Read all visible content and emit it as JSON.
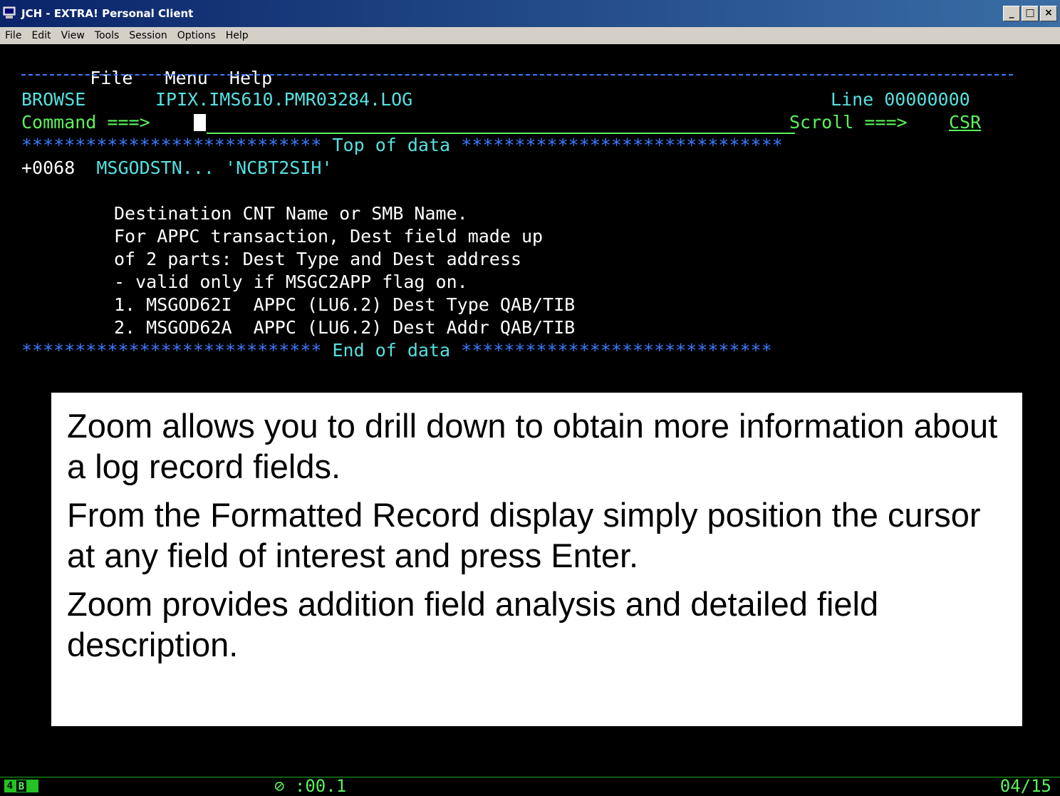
{
  "window": {
    "title": "JCH - EXTRA! Personal Client",
    "buttons": [
      "_",
      "□",
      "×"
    ]
  },
  "menubar": [
    "File",
    "Edit",
    "View",
    "Tools",
    "Session",
    "Options",
    "Help"
  ],
  "terminal": {
    "menu": {
      "file": "File",
      "menu": "Menu",
      "help": "Help"
    },
    "mode": "BROWSE",
    "dataset": "IPIX.IMS610.PMR03284.LOG",
    "line_label": "Line 00000000",
    "command_label": "Command ===>",
    "scroll_label": "Scroll ===>",
    "scroll_value": "CSR",
    "top_stars_left": "****************************",
    "top_label": "Top of data",
    "top_stars_right": "******************************",
    "record": {
      "offset": "+0068",
      "field": "MSGODSTN...",
      "value": "'NCBT2SIH'"
    },
    "description": [
      "Destination CNT Name or SMB Name.",
      "For APPC transaction, Dest field made up",
      "of 2 parts: Dest Type and Dest address",
      "- valid only if MSGC2APP flag on.",
      "1. MSGOD62I  APPC (LU6.2) Dest Type QAB/TIB",
      "2. MSGOD62A  APPC (LU6.2) Dest Addr QAB/TIB"
    ],
    "end_stars_left": "****************************",
    "end_label": "End of data",
    "end_stars_right": "*****************************"
  },
  "overlay": [
    "Zoom allows you to drill down to obtain more information about  a log record fields.",
    "From the Formatted Record display simply position the cursor at any field of interest and press Enter.",
    "Zoom provides addition field analysis and detailed field description."
  ],
  "status": {
    "indicator_a": "4",
    "indicator_b": "B",
    "timer": "⊘ :00.1",
    "position": "04/15"
  }
}
